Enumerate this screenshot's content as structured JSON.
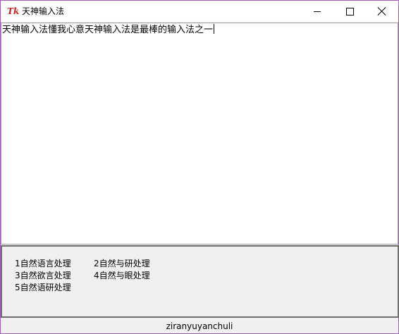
{
  "window": {
    "icon_text": "Tk",
    "title": "天神输入法"
  },
  "controls": {
    "minimize": "minimize",
    "maximize": "maximize",
    "close": "close"
  },
  "editor": {
    "text": "天神输入法懂我心意天神输入法是最棒的输入法之一"
  },
  "candidates": [
    "1自然语言处理",
    "2自然与研处理",
    "3自然欲言处理",
    "4自然与眼处理",
    "5自然语研处理"
  ],
  "pinyin": "ziranyuyanchuli"
}
